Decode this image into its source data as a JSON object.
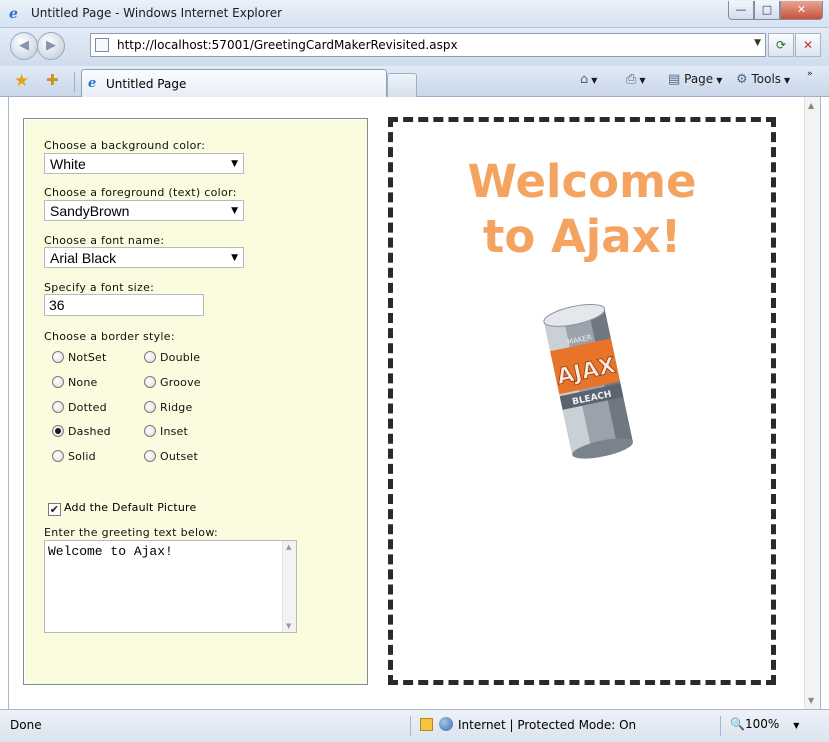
{
  "window": {
    "title": "Untitled Page - Windows Internet Explorer",
    "min_glyph": "—",
    "max_glyph": "□",
    "close_glyph": "✕"
  },
  "nav": {
    "back_glyph": "◀",
    "forward_glyph": "▶",
    "url": "http://localhost:57001/GreetingCardMakerRevisited.aspx",
    "refresh_glyph": "⟳",
    "stop_glyph": "✕"
  },
  "tabs": {
    "active_label": "Untitled Page",
    "commands": {
      "page_label": "Page",
      "tools_label": "Tools",
      "more_glyph": "»"
    }
  },
  "form": {
    "bg_color_label": "Choose a background color:",
    "bg_color_value": "White",
    "fg_color_label": "Choose a foreground (text) color:",
    "fg_color_value": "SandyBrown",
    "font_name_label": "Choose a font name:",
    "font_name_value": "Arial Black",
    "font_size_label": "Specify a font size:",
    "font_size_value": "36",
    "border_style_label": "Choose a border style:",
    "border_styles": [
      {
        "label": "NotSet",
        "selected": false
      },
      {
        "label": "None",
        "selected": false
      },
      {
        "label": "Dotted",
        "selected": false
      },
      {
        "label": "Dashed",
        "selected": true
      },
      {
        "label": "Solid",
        "selected": false
      },
      {
        "label": "Double",
        "selected": false
      },
      {
        "label": "Groove",
        "selected": false
      },
      {
        "label": "Ridge",
        "selected": false
      },
      {
        "label": "Inset",
        "selected": false
      },
      {
        "label": "Outset",
        "selected": false
      }
    ],
    "default_picture_label": "Add the Default Picture",
    "default_picture_checked": true,
    "greeting_label": "Enter the greeting text below:",
    "greeting_value": "Welcome to Ajax!"
  },
  "card": {
    "line1": "Welcome",
    "line2": "to Ajax!",
    "text_color": "#f4a460",
    "picture": {
      "top_label": "MAKER",
      "brand": "AJAX",
      "sub": "BLEACH"
    }
  },
  "status": {
    "left": "Done",
    "zone": "Internet | Protected Mode: On",
    "zoom": "100%"
  }
}
